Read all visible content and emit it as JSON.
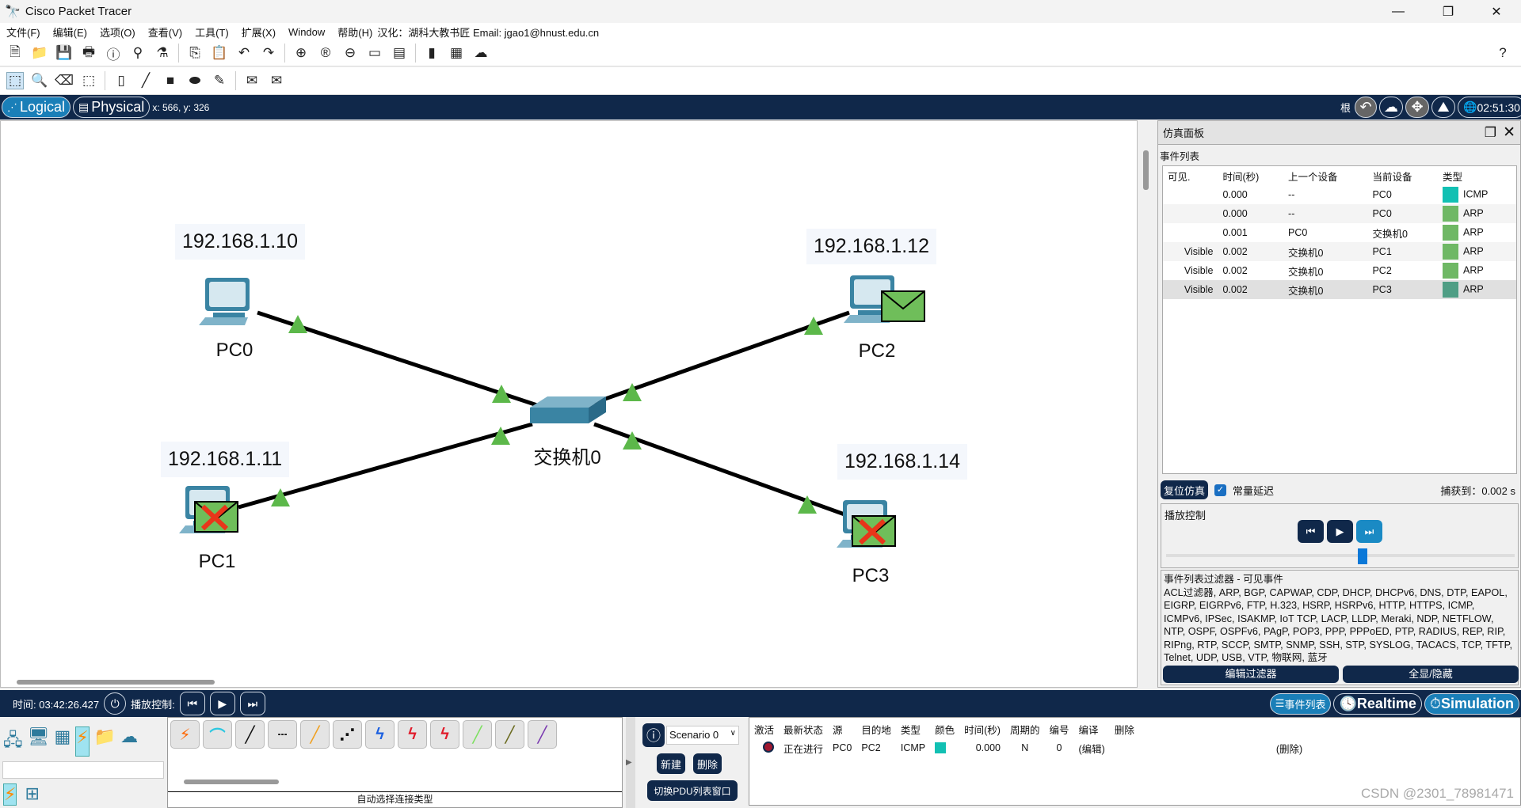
{
  "window": {
    "title": "Cisco Packet Tracer",
    "controls": [
      "—",
      "❐",
      "✕"
    ]
  },
  "menu": [
    "文件(F)",
    "编辑(E)",
    "选项(O)",
    "查看(V)",
    "工具(T)",
    "扩展(X)",
    "Window",
    "帮助(H)",
    "汉化：湖科大教书匠  Email: jgao1@hnust.edu.cn"
  ],
  "nav": {
    "logical": "Logical",
    "physical": "Physical",
    "coords": "x: 566, y: 326",
    "root": "根",
    "clock": "02:51:30"
  },
  "devices": [
    {
      "name": "PC0",
      "ip": "192.168.1.10"
    },
    {
      "name": "PC1",
      "ip": "192.168.1.11"
    },
    {
      "name": "PC2",
      "ip": "192.168.1.12"
    },
    {
      "name": "PC3",
      "ip": "192.168.1.14"
    },
    {
      "name": "交换机0"
    }
  ],
  "sim": {
    "title": "仿真面板",
    "event_list": "事件列表",
    "columns": [
      "可见.",
      "时间(秒)",
      "上一个设备",
      "当前设备",
      "类型"
    ],
    "events": [
      {
        "vis": "",
        "time": "0.000",
        "last": "--",
        "at": "PC0",
        "type": "ICMP",
        "color": "#12c0b3"
      },
      {
        "vis": "",
        "time": "0.000",
        "last": "--",
        "at": "PC0",
        "type": "ARP",
        "color": "#6fb865"
      },
      {
        "vis": "",
        "time": "0.001",
        "last": "PC0",
        "at": "交换机0",
        "type": "ARP",
        "color": "#6fb865"
      },
      {
        "vis": "Visible",
        "time": "0.002",
        "last": "交换机0",
        "at": "PC1",
        "type": "ARP",
        "color": "#6fb865"
      },
      {
        "vis": "Visible",
        "time": "0.002",
        "last": "交换机0",
        "at": "PC2",
        "type": "ARP",
        "color": "#6fb865"
      },
      {
        "vis": "Visible",
        "time": "0.002",
        "last": "交换机0",
        "at": "PC3",
        "type": "ARP",
        "color": "#4f9e85"
      }
    ],
    "reset": "复位仿真",
    "constant_delay": "常量延迟",
    "captured": "捕获到：0.002 s",
    "playback": "播放控制",
    "playback_slider_fraction": 0.55,
    "filter_title": "事件列表过滤器 - 可见事件",
    "filter_text": "ACL过滤器, ARP, BGP, CAPWAP, CDP, DHCP, DHCPv6, DNS, DTP, EAPOL, EIGRP, EIGRPv6, FTP, H.323, HSRP, HSRPv6, HTTP, HTTPS, ICMP, ICMPv6, IPSec, ISAKMP, IoT TCP, LACP, LLDP, Meraki, NDP, NETFLOW, NTP, OSPF, OSPFv6, PAgP, POP3, PPP, PPPoED, PTP, RADIUS, REP, RIP, RIPng, RTP, SCCP, SMTP, SNMP, SSH, STP, SYSLOG, TACACS, TCP, TFTP, Telnet, UDP, USB, VTP, 物联网, 蓝牙",
    "edit_filter": "编辑过滤器",
    "show_all": "全显/隐藏"
  },
  "bottom": {
    "time": "时间: 03:42:26.427",
    "playback": "播放控制:",
    "event_list": "事件列表",
    "realtime": "Realtime",
    "simulation": "Simulation"
  },
  "cables_caption": "自动选择连接类型",
  "scenario": {
    "value": "Scenario 0",
    "new": "新建",
    "delete": "删除",
    "toggle": "切换PDU列表窗口"
  },
  "pdu": {
    "columns": [
      "激活",
      "最新状态",
      "源",
      "目的地",
      "类型",
      "颜色",
      "时间(秒)",
      "周期的",
      "编号",
      "编译",
      "删除"
    ],
    "rows": [
      {
        "status": "正在进行",
        "src": "PC0",
        "dst": "PC2",
        "type": "ICMP",
        "color": "#12c0b3",
        "time": "0.000",
        "periodic": "N",
        "num": "0",
        "edit": "(编辑)",
        "del": "(删除)"
      }
    ]
  },
  "watermark": "CSDN @2301_78981471"
}
